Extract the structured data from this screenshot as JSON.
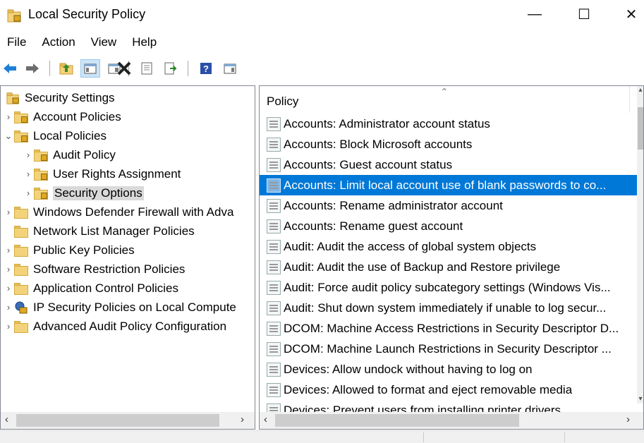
{
  "window": {
    "title": "Local Security Policy",
    "controls": {
      "minimize": "—",
      "maximize": "☐",
      "close": "✕"
    }
  },
  "menu": [
    "File",
    "Action",
    "View",
    "Help"
  ],
  "toolbar": {
    "buttons": [
      "back-icon",
      "forward-icon",
      "up-folder-icon",
      "show-hide-tree-icon",
      "delete-icon",
      "properties-icon",
      "export-list-icon",
      "help-icon",
      "show-hide-action-pane-icon"
    ]
  },
  "tree": {
    "root": "Security Settings",
    "items": [
      {
        "label": "Account Policies",
        "arrow": "›"
      },
      {
        "label": "Local Policies",
        "arrow": "⌄"
      },
      {
        "label": "Audit Policy",
        "arrow": "›"
      },
      {
        "label": "User Rights Assignment",
        "arrow": "›"
      },
      {
        "label": "Security Options",
        "arrow": "›"
      },
      {
        "label": "Windows Defender Firewall with Adva",
        "arrow": "›"
      },
      {
        "label": "Network List Manager Policies",
        "arrow": ""
      },
      {
        "label": "Public Key Policies",
        "arrow": "›"
      },
      {
        "label": "Software Restriction Policies",
        "arrow": "›"
      },
      {
        "label": "Application Control Policies",
        "arrow": "›"
      },
      {
        "label": "IP Security Policies on Local Compute",
        "arrow": "›"
      },
      {
        "label": "Advanced Audit Policy Configuration",
        "arrow": "›"
      }
    ]
  },
  "list": {
    "header": "Policy",
    "rows": [
      "Accounts: Administrator account status",
      "Accounts: Block Microsoft accounts",
      "Accounts: Guest account status",
      "Accounts: Limit local account use of blank passwords to co...",
      "Accounts: Rename administrator account",
      "Accounts: Rename guest account",
      "Audit: Audit the access of global system objects",
      "Audit: Audit the use of Backup and Restore privilege",
      "Audit: Force audit policy subcategory settings (Windows Vis...",
      "Audit: Shut down system immediately if unable to log secur...",
      "DCOM: Machine Access Restrictions in Security Descriptor D...",
      "DCOM: Machine Launch Restrictions in Security Descriptor ...",
      "Devices: Allow undock without having to log on",
      "Devices: Allowed to format and eject removable media",
      "Devices: Prevent users from installing printer drivers"
    ],
    "selected_index": 3
  },
  "colors": {
    "selection": "#0078d7",
    "tree_selection": "#d9d9d9",
    "folder": "#f3d37a"
  }
}
